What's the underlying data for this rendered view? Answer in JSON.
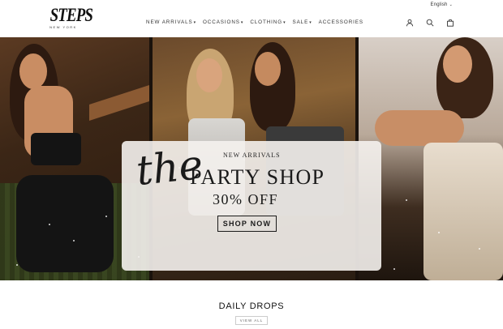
{
  "header": {
    "brand": "STEPS",
    "brand_sub": "NEW YORK",
    "language": "English",
    "nav": [
      {
        "label": "NEW ARRIVALS",
        "has_dropdown": true
      },
      {
        "label": "OCCASIONS",
        "has_dropdown": true
      },
      {
        "label": "CLOTHING",
        "has_dropdown": true
      },
      {
        "label": "SALE",
        "has_dropdown": true
      },
      {
        "label": "ACCESSORIES",
        "has_dropdown": false
      }
    ],
    "icons": [
      "account-icon",
      "search-icon",
      "cart-icon"
    ]
  },
  "hero": {
    "script_word": "the",
    "eyebrow": "NEW ARRIVALS",
    "title": "PARTY SHOP",
    "discount": "30% OFF",
    "cta": "SHOP NOW"
  },
  "section": {
    "title": "DAILY DROPS",
    "view_all": "VIEW ALL"
  },
  "colors": {
    "text": "#222222",
    "promo_bg": "#f5f2ee"
  }
}
